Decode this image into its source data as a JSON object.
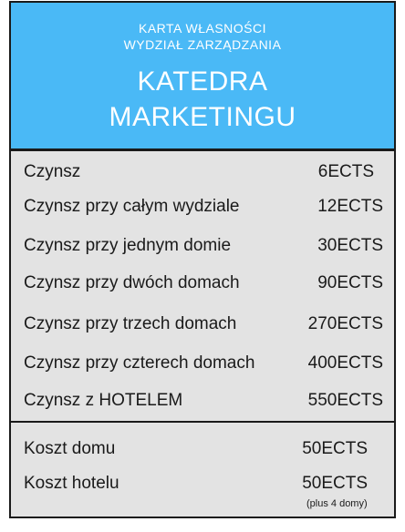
{
  "header": {
    "card_type": "KARTA WŁASNOŚCI",
    "faculty": "WYDZIAŁ ZARZĄDZANIA",
    "name_line1": "KATEDRA",
    "name_line2": "MARKETINGU"
  },
  "rents": [
    {
      "label": "Czynsz",
      "value": "6ECTS"
    },
    {
      "label": "Czynsz przy całym wydziale",
      "value": "12ECTS"
    },
    {
      "label": "Czynsz przy jednym domie",
      "value": "30ECTS"
    },
    {
      "label": "Czynsz przy dwóch domach",
      "value": "90ECTS"
    },
    {
      "label": "Czynsz przy trzech domach",
      "value": "270ECTS"
    },
    {
      "label": "Czynsz przy czterech domach",
      "value": "400ECTS"
    },
    {
      "label": "Czynsz z HOTELEM",
      "value": "550ECTS"
    }
  ],
  "costs": [
    {
      "label": "Koszt domu",
      "value": "50ECTS"
    },
    {
      "label": "Koszt hotelu",
      "value": "50ECTS"
    }
  ],
  "hotel_note": "(plus 4 domy)",
  "colors": {
    "header": "#4ab9f6",
    "body": "#e3e3e3",
    "border": "#1a1a1a"
  }
}
